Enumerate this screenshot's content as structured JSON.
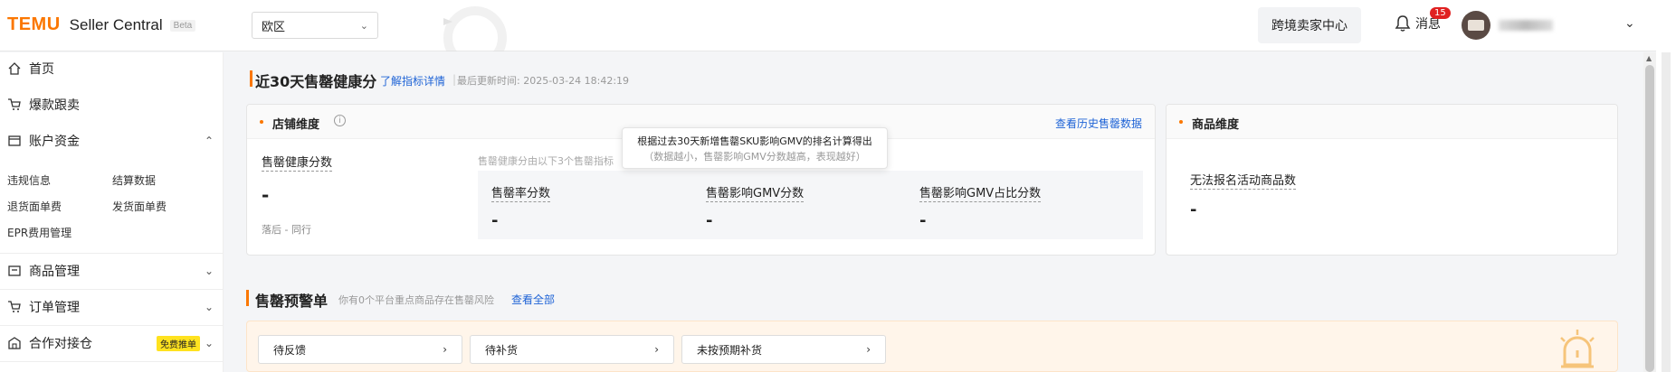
{
  "header": {
    "logo_brand": "TEMU",
    "logo_product": "Seller Central",
    "logo_badge": "Beta",
    "region": "欧区",
    "cross_border_center": "跨境卖家中心",
    "messages_label": "消息",
    "messages_count": "15"
  },
  "sidebar": {
    "home": "首页",
    "hot_sales": "爆款跟卖",
    "account_funds": "账户资金",
    "sub_items": [
      "违规信息",
      "结算数据",
      "退货面单费",
      "发货面单费",
      "EPR费用管理"
    ],
    "product_mgmt": "商品管理",
    "order_mgmt": "订单管理",
    "coop_warehouse": "合作对接仓",
    "coop_badge": "免费推单"
  },
  "health": {
    "title": "近30天售罄健康分",
    "learn_link": "了解指标详情",
    "separator": "|",
    "updated": "最后更新时间: 2025-03-24 18:42:19"
  },
  "store_card": {
    "title": "店铺维度",
    "history_link": "查看历史售罄数据",
    "score_label": "售罄健康分数",
    "score_value": "-",
    "score_sub": "落后 - 同行",
    "composition_note": "售罄健康分由以下3个售罄指标",
    "metrics": [
      {
        "label": "售罄率分数",
        "value": "-"
      },
      {
        "label": "售罄影响GMV分数",
        "value": "-"
      },
      {
        "label": "售罄影响GMV占比分数",
        "value": "-"
      }
    ]
  },
  "tooltip": {
    "line1": "根据过去30天新增售罄SKU影响GMV的排名计算得出",
    "line2": "（数据越小，售罄影响GMV分数越高，表现越好）"
  },
  "product_card": {
    "title": "商品维度",
    "label": "无法报名活动商品数",
    "value": "-"
  },
  "warning": {
    "title": "售罄预警单",
    "desc": "你有0个平台重点商品存在售罄风险",
    "view_all": "查看全部",
    "pills": [
      "待反馈",
      "待补货",
      "未按预期补货"
    ]
  },
  "icons": {
    "home": "home-icon",
    "hot_sales": "cart-icon",
    "account_funds": "wallet-icon",
    "product_mgmt": "box-icon",
    "order_mgmt": "cart-icon",
    "coop_warehouse": "warehouse-icon",
    "messages": "bell-icon"
  },
  "colors": {
    "brand": "#fb7701",
    "link": "#1e63d6",
    "badge_red": "#e02020",
    "badge_yellow": "#ffe21f"
  }
}
